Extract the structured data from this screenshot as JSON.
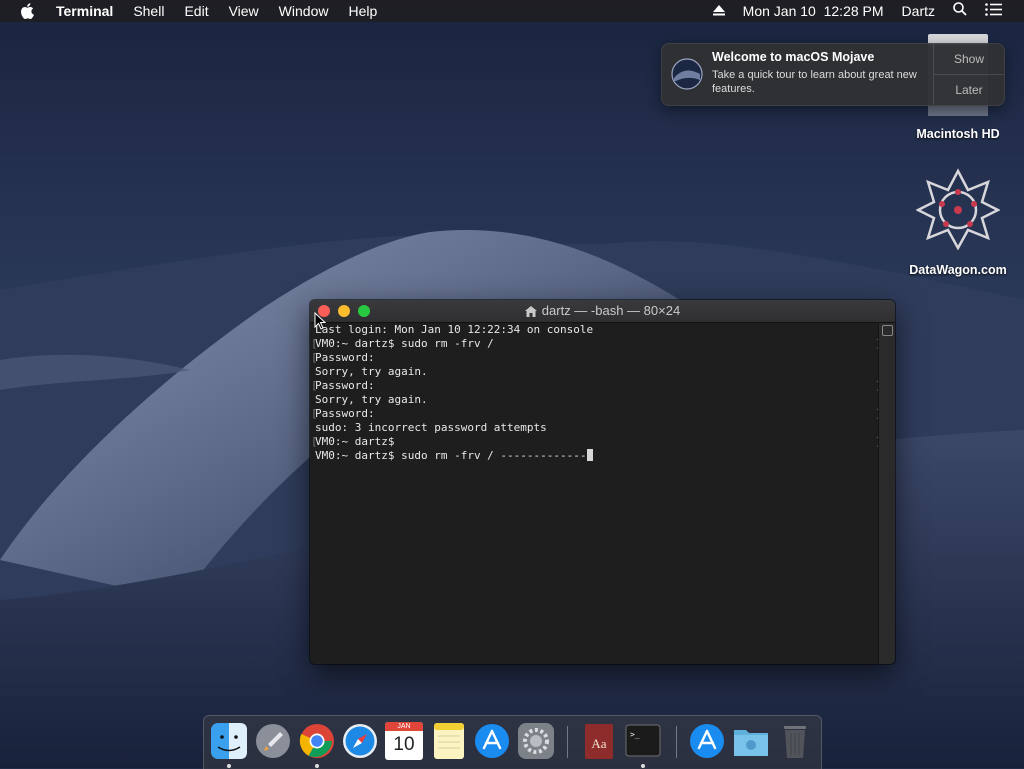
{
  "menubar": {
    "app_name": "Terminal",
    "menus": [
      "Shell",
      "Edit",
      "View",
      "Window",
      "Help"
    ],
    "date_time": "Mon Jan 10  12:28 PM",
    "user": "Dartz"
  },
  "notification": {
    "title": "Welcome to macOS Mojave",
    "body": "Take a quick tour to learn about great new features.",
    "show_label": "Show",
    "later_label": "Later"
  },
  "desktop": {
    "icons": [
      {
        "label": "Macintosh HD"
      },
      {
        "label": "DataWagon.com"
      }
    ]
  },
  "terminal": {
    "title": "dartz — -bash — 80×24",
    "lines": [
      "Last login: Mon Jan 10 12:22:34 on console",
      "VM0:~ dartz$ sudo rm -frv /",
      "Password:",
      "Sorry, try again.",
      "Password:",
      "Sorry, try again.",
      "Password:",
      "sudo: 3 incorrect password attempts",
      "VM0:~ dartz$",
      "VM0:~ dartz$ sudo rm -frv / -------------"
    ]
  },
  "dock": {
    "apps": [
      "Finder",
      "Launchpad",
      "Google Chrome",
      "Safari",
      "Calendar",
      "Notes",
      "App Store",
      "System Preferences",
      "Dictionary",
      "Terminal",
      "App Store Downloads",
      "Downloads",
      "Trash"
    ],
    "calendar_month": "JAN",
    "calendar_day": "10"
  },
  "colors": {
    "close": "#fc5f57",
    "minimize": "#fdbc2e",
    "maximize": "#28c840"
  }
}
